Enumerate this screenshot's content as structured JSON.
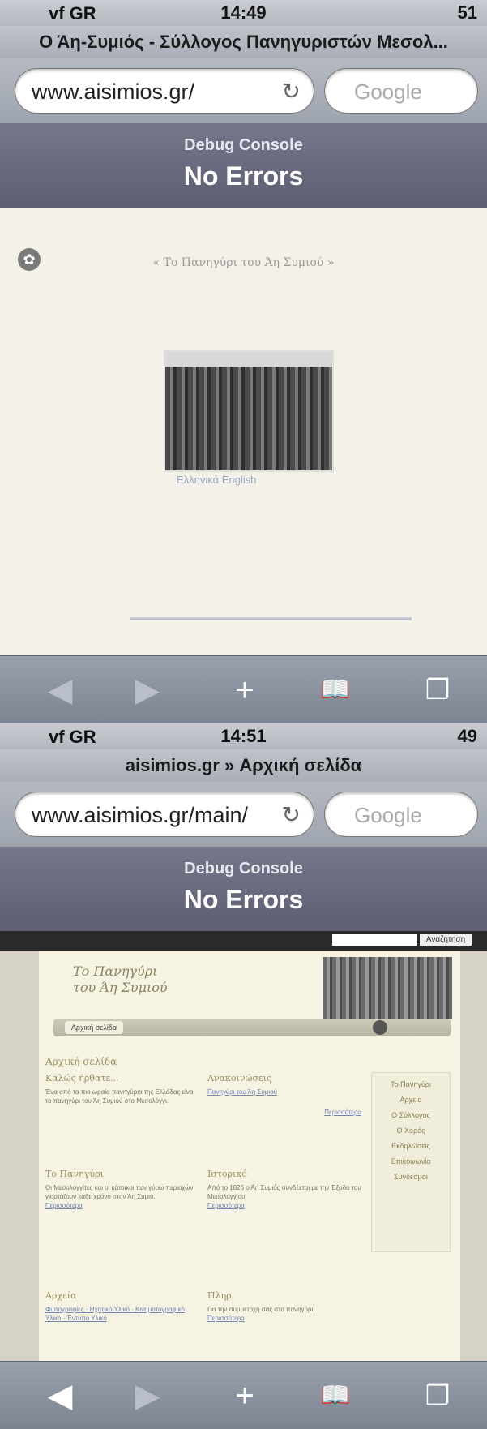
{
  "screen1": {
    "status": {
      "carrier": "vf GR",
      "time": "14:49",
      "battery": "51"
    },
    "title": "Ο Άη-Συμιός - Σύλλογος Πανηγυριστών Μεσολ...",
    "url": "www.aisimios.gr/",
    "search_placeholder": "Google",
    "debug": {
      "label": "Debug Console",
      "status": "No Errors"
    },
    "page": {
      "crumb": "« Το Πανηγύρι του Άη Συμιού »",
      "langs": "Ελληνικά     English"
    }
  },
  "screen2": {
    "status": {
      "carrier": "vf GR",
      "time": "14:51",
      "battery": "49"
    },
    "title": "aisimios.gr » Αρχική σελίδα",
    "url": "www.aisimios.gr/main/",
    "search_placeholder": "Google",
    "debug": {
      "label": "Debug Console",
      "status": "No Errors"
    },
    "page": {
      "search_button": "Αναζήτηση",
      "site_title_1": "Το Πανηγύρι",
      "site_title_2": "του Άη Συμιού",
      "nav_tab": "Αρχική σελίδα",
      "heading": "Αρχική σελίδα",
      "sections": [
        {
          "title": "Καλώς ήρθατε...",
          "text": "Ένα από τα πιο ωραία πανηγύρια της Ελλάδας είναι το πανηγύρι του Άη Συμιού στο Μεσολόγγι."
        },
        {
          "title": "Ανακοινώσεις",
          "text": "Πανηγύρι του Άη Συμιού",
          "link": "Περισσότερα"
        },
        {
          "title": "Το Πανηγύρι",
          "text": "Οι Μεσολογγίτες και οι κάτοικοι των γύρω περιοχών γιορτάζουν κάθε χρόνο στον Άη Συμιό.",
          "link": "Περισσότερα"
        },
        {
          "title": "Ιστορικό",
          "text": "Από το 1826 ο Άη Συμιός συνδέεται με την Έξοδο του Μεσολογγίου.",
          "link": "Περισσότερα"
        },
        {
          "title": "Αρχεία",
          "text": "Φωτογραφίες · Ηχητικό Υλικό · Κινηματογραφικό Υλικό · Έντυπο Υλικό"
        },
        {
          "title": "Πληρ.",
          "text": "Για την συμμετοχή σας στο πανηγύρι.",
          "link": "Περισσότερα"
        }
      ],
      "sidebar": [
        "Το Πανηγύρι",
        "Αρχεία",
        "Ο Σύλλογος",
        "Ο Χορός",
        "Εκδηλώσεις",
        "Επικοινωνία",
        "Σύνδεσμοι"
      ]
    }
  },
  "toolbar": {
    "back": "◀",
    "forward": "▶",
    "add": "+",
    "bookmarks": "📖",
    "tabs": "❐"
  }
}
